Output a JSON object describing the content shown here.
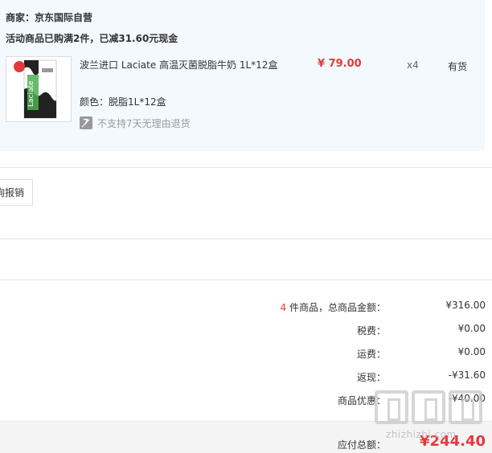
{
  "order": {
    "merchant": "商家：京东国际自营",
    "promo": "活动商品已购满2件，已减31.60元现金"
  },
  "product": {
    "name": "波兰进口 Laciate 高温灭菌脱脂牛奶 1L*12盒",
    "price": "¥ 79.00",
    "quantity": "x4",
    "stock": "有货",
    "color": "颜色：脱脂1L*12盒",
    "return_policy_icon_text": "7",
    "return_policy": "不支持7天无理由退货",
    "thumbnail_brand": "Laciate"
  },
  "invoice": {
    "button_label": "询报销"
  },
  "summary": {
    "count": "4",
    "goods_total_label": " 件商品，总商品金额：",
    "goods_total": "¥316.00",
    "tax_label": "税费：",
    "tax": "¥0.00",
    "shipping_label": "运费：",
    "shipping": "¥0.00",
    "rebate_label": "返现：",
    "rebate": "-¥31.60",
    "discount_label": "商品优惠：",
    "discount": "-¥40.00",
    "payable_label": "应付总额：",
    "payable": "¥244.40"
  },
  "watermark": {
    "text": "zhizhizhi.com"
  },
  "colors": {
    "accent_red": "#e4393c",
    "panel_bg": "#f3f9fd"
  }
}
